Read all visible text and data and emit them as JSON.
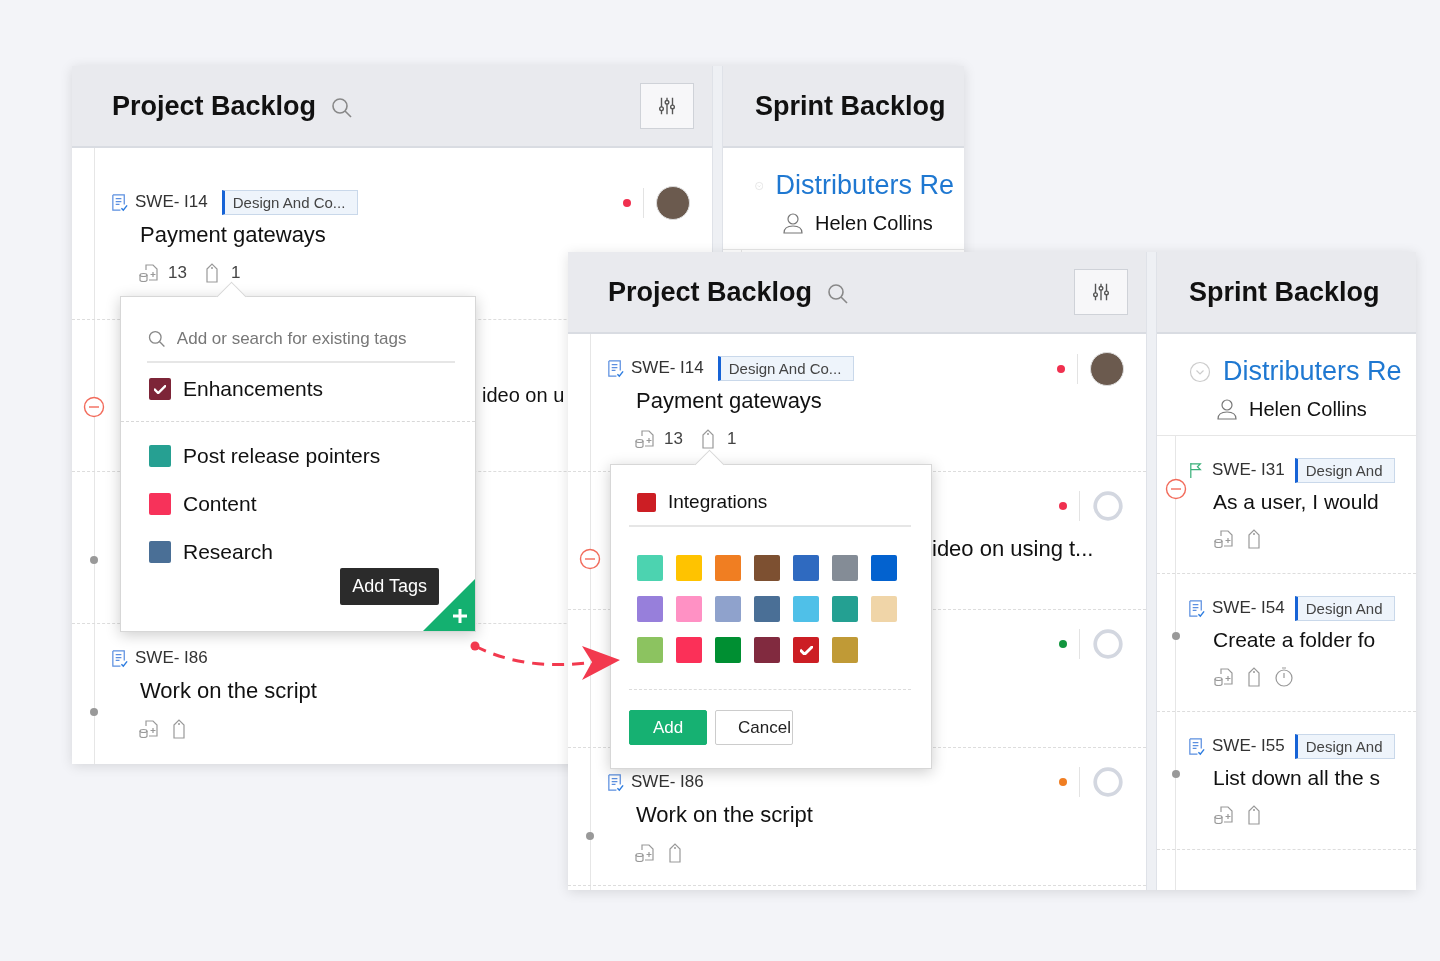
{
  "screens": [
    {
      "project": {
        "title": "Project Backlog",
        "items": [
          {
            "kind": "task",
            "id": "SWE- I14",
            "tag": "Design And Co...",
            "title": "Payment gateways",
            "color": "#f0304f",
            "assigned": true,
            "counts": [
              "13",
              "1"
            ]
          },
          {
            "kind": "covered",
            "title": "ideo on u",
            "blocked": true
          },
          {
            "kind": "covered",
            "blocked": false
          },
          {
            "kind": "task",
            "id": "SWE- I86",
            "title": "Work on the script",
            "blocked": false
          }
        ]
      },
      "sprint": {
        "title": "Sprint Backlog",
        "epic": {
          "title": "Distributers Re",
          "owner": "Helen Collins"
        }
      },
      "popover": {
        "kind": "tags",
        "placeholder": "Add or search for existing tags",
        "tooltip": "Add Tags",
        "tags": [
          {
            "name": "Enhancements",
            "color": "#7d2538",
            "checked": true
          },
          {
            "name": "Post release pointers",
            "color": "#26a092",
            "checked": false
          },
          {
            "name": "Content",
            "color": "#f7325a",
            "checked": false
          },
          {
            "name": "Research",
            "color": "#4a6f96",
            "checked": false
          }
        ]
      }
    },
    {
      "project": {
        "title": "Project Backlog",
        "items": [
          {
            "kind": "task",
            "id": "SWE- I14",
            "tag": "Design And Co...",
            "title": "Payment gateways",
            "color": "#f0304f",
            "assigned": true,
            "counts": [
              "13",
              "1"
            ]
          },
          {
            "kind": "covered",
            "title": "ideo on using t...",
            "blocked": true,
            "color": "#f0304f",
            "assigned": false
          },
          {
            "kind": "covered",
            "color": "#12963e",
            "assigned": false
          },
          {
            "kind": "task",
            "id": "SWE- I86",
            "title": "Work on the script",
            "color": "#f07e22",
            "assigned": false,
            "blocked": false
          }
        ]
      },
      "sprint": {
        "title": "Sprint Backlog",
        "epic": {
          "title": "Distributers Re",
          "owner": "Helen Collins"
        },
        "items": [
          {
            "story": true,
            "id": "SWE- I31",
            "tag": "Design And",
            "title": "As a user, I would",
            "blocked": true
          },
          {
            "story": false,
            "id": "SWE- I54",
            "tag": "Design And",
            "title": "Create a folder fo",
            "blocked": false,
            "timer": true
          },
          {
            "story": false,
            "id": "SWE- I55",
            "tag": "Design And",
            "title": "List down all the s",
            "blocked": false
          }
        ]
      },
      "popover": {
        "kind": "colors",
        "label": "Integrations",
        "color": "#cc1e24",
        "buttons": [
          "Add",
          "Cancel"
        ],
        "swatches": [
          {
            "color": "#4cd3b0",
            "selected": false
          },
          {
            "color": "#ffc300",
            "selected": false
          },
          {
            "color": "#f07e22",
            "selected": false
          },
          {
            "color": "#7d5031",
            "selected": false
          },
          {
            "color": "#2f6ac0",
            "selected": false
          },
          {
            "color": "#848c96",
            "selected": false
          },
          {
            "color": "#0362cf",
            "selected": false
          },
          {
            "color": "#977fdb",
            "selected": false
          },
          {
            "color": "#ff91c4",
            "selected": false
          },
          {
            "color": "#8fa2cc",
            "selected": false
          },
          {
            "color": "#4a6f96",
            "selected": false
          },
          {
            "color": "#4fc0e8",
            "selected": false
          },
          {
            "color": "#24a092",
            "selected": false
          },
          {
            "color": "#f0d5a8",
            "selected": false
          },
          {
            "color": "#8cc360",
            "selected": false
          },
          {
            "color": "#fb3058",
            "selected": false
          },
          {
            "color": "#008f32",
            "selected": false
          },
          {
            "color": "#812a3f",
            "selected": false
          },
          {
            "color": "#cc1e24",
            "selected": true
          },
          {
            "color": "#c09a36",
            "selected": false
          }
        ]
      }
    }
  ]
}
